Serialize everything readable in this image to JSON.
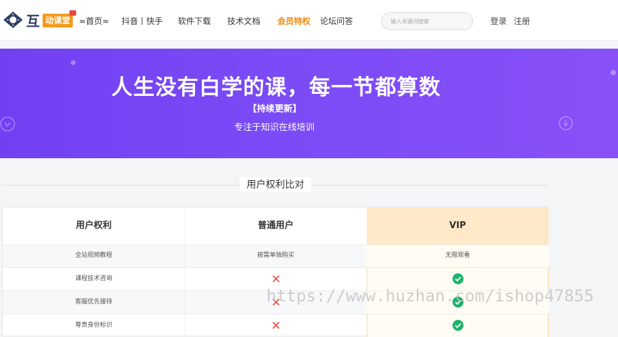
{
  "header": {
    "logo_main": "互",
    "logo_badge": "动课堂",
    "nav": [
      {
        "label": "≈首页≈",
        "active": false
      },
      {
        "label": "抖音丨快手",
        "active": false
      },
      {
        "label": "软件下载",
        "active": false
      },
      {
        "label": "技术文档",
        "active": false
      },
      {
        "label": "会员特权",
        "active": true
      },
      {
        "label": "论坛问答",
        "active": false
      }
    ],
    "search_placeholder": "输入关键词搜索",
    "login": "登录",
    "register": "注册"
  },
  "banner": {
    "title": "人生没有白学的课，每一节都算数",
    "tag": "【持续更新】",
    "subtitle": "专注于知识在线培训"
  },
  "section": {
    "title": "用户权利比对"
  },
  "compare_table": {
    "headers": [
      "用户权利",
      "普通用户",
      "VIP"
    ],
    "rows": [
      {
        "feature": "全站视频教程",
        "normal": "按需单独购买",
        "vip": "无限观看"
      },
      {
        "feature": "课程技术咨询",
        "normal": "cross",
        "vip": "check"
      },
      {
        "feature": "客服优先接待",
        "normal": "cross",
        "vip": "check"
      },
      {
        "feature": "尊贵身份标识",
        "normal": "cross",
        "vip": "check"
      }
    ]
  },
  "icons": {
    "cross_color": "#e84c3d",
    "check_color": "#1fb36b"
  },
  "colors": {
    "accent": "#f08a12",
    "banner": "#7a4bf6",
    "vip_header": "#fde8c8"
  },
  "watermark": "https://www.huzhan.com/ishop47855"
}
